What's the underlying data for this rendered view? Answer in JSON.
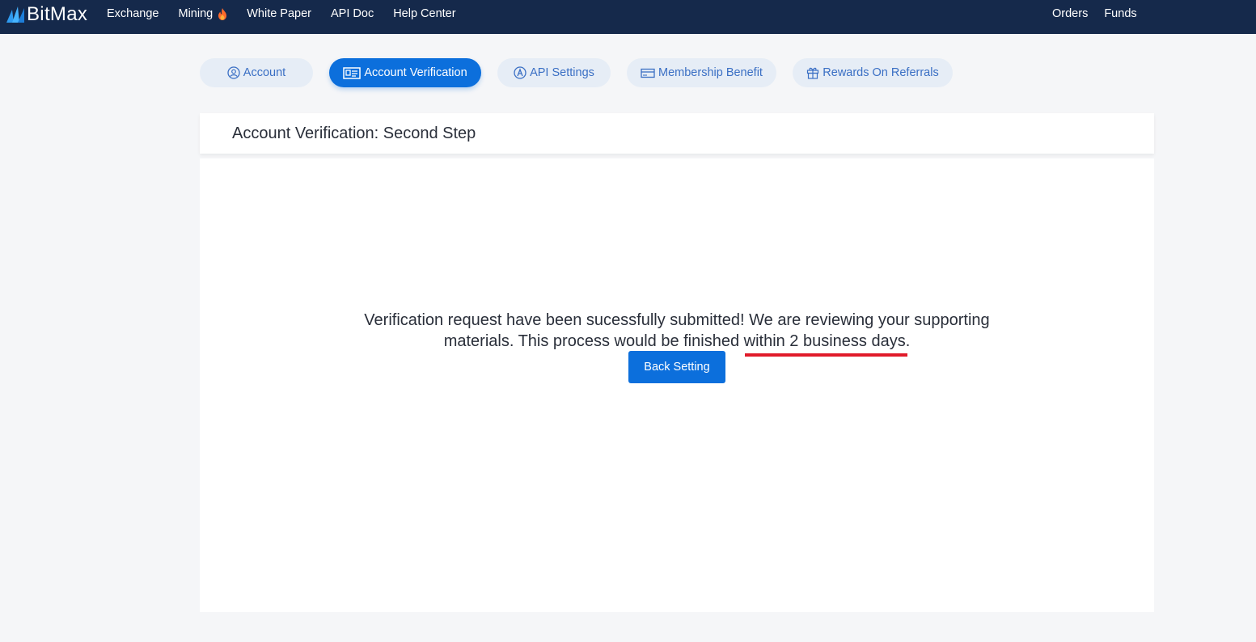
{
  "brand": {
    "name": "BitMax"
  },
  "nav": {
    "left": [
      {
        "label": "Exchange"
      },
      {
        "label": "Mining",
        "icon": "fire-icon"
      },
      {
        "label": "White Paper"
      },
      {
        "label": "API Doc"
      },
      {
        "label": "Help Center"
      }
    ],
    "right": [
      {
        "label": "Orders"
      },
      {
        "label": "Funds"
      }
    ]
  },
  "tabs": [
    {
      "label": "Account",
      "icon": "user-circle-icon",
      "active": false
    },
    {
      "label": "Account Verification",
      "icon": "id-card-icon",
      "active": true
    },
    {
      "label": "API Settings",
      "icon": "api-icon",
      "active": false
    },
    {
      "label": "Membership Benefit",
      "icon": "card-icon",
      "active": false
    },
    {
      "label": "Rewards On Referrals",
      "icon": "gift-icon",
      "active": false
    }
  ],
  "page": {
    "title": "Account Verification: Second Step",
    "message": "Verification request have been sucessfully submitted! We are reviewing your supporting materials. This process would be finished within 2 business days.",
    "back_button": "Back Setting"
  },
  "colors": {
    "topbar": "#15294b",
    "accent": "#0c6fdc",
    "tab_bg": "#e6edf6",
    "annotation_underline": "#e01b2a"
  }
}
